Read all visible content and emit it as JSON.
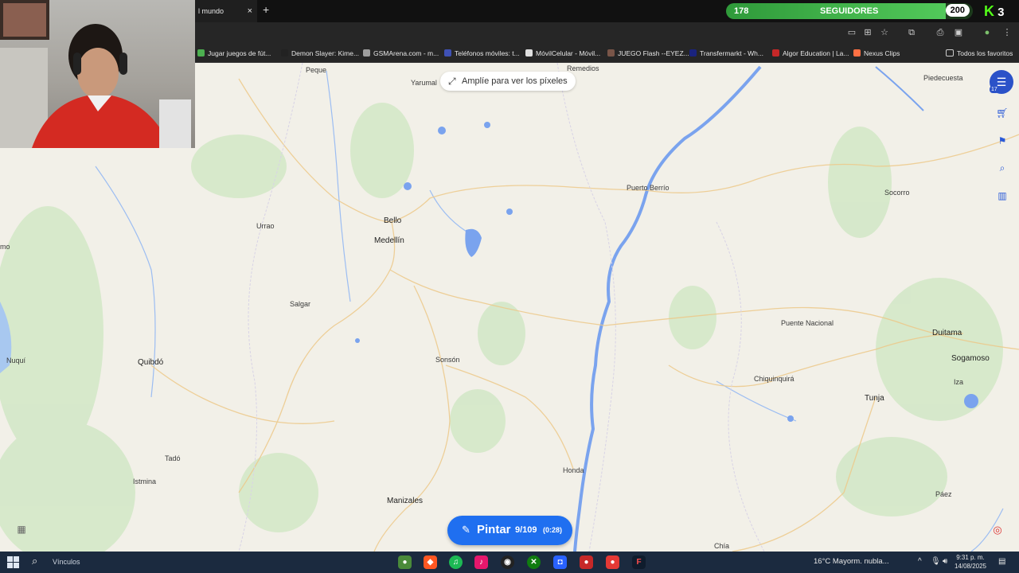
{
  "browser": {
    "tab_title": "l mundo",
    "tab_close": "×",
    "new_tab": "+",
    "bookmarks": [
      {
        "label": "Jugar juegos de fút...",
        "color": "#4caf50"
      },
      {
        "label": "Demon Slayer: Kime...",
        "color": "#222222"
      },
      {
        "label": "GSMArena.com - m...",
        "color": "#9e9e9e"
      },
      {
        "label": "Teléfonos móviles: t...",
        "color": "#3f51b5"
      },
      {
        "label": "MóvilCelular - Móvil...",
        "color": "#e0e0e0"
      },
      {
        "label": "JUEGO Flash --EYEZ...",
        "color": "#795548"
      },
      {
        "label": "Transfermarkt - Wh...",
        "color": "#1a237e"
      },
      {
        "label": "Algor Education | La...",
        "color": "#c62828"
      },
      {
        "label": "Nexus Clips",
        "color": "#ff7043"
      }
    ],
    "all_bookmarks": "Todos los favoritos"
  },
  "stream": {
    "followers_current": "178",
    "followers_label": "SEGUIDORES",
    "followers_goal": "200",
    "followers_progress": 0.89,
    "kick_letter": "K",
    "kick_count": "3"
  },
  "map": {
    "zoom_hint": "Amplíe para ver los píxeles",
    "cities": [
      {
        "name": "Peque",
        "bold": false
      },
      {
        "name": "Yarumal",
        "bold": false
      },
      {
        "name": "Remedios",
        "bold": false
      },
      {
        "name": "Piedecuesta",
        "bold": false
      },
      {
        "name": "Puerto Berrío",
        "bold": false
      },
      {
        "name": "Socorro",
        "bold": false
      },
      {
        "name": "Bello",
        "bold": true
      },
      {
        "name": "Medellín",
        "bold": true
      },
      {
        "name": "Urrao",
        "bold": false
      },
      {
        "name": "Salgar",
        "bold": false
      },
      {
        "name": "Puente Nacional",
        "bold": false
      },
      {
        "name": "Duitama",
        "bold": true
      },
      {
        "name": "Sogamoso",
        "bold": true
      },
      {
        "name": "Nuquí",
        "bold": false
      },
      {
        "name": "Quibdó",
        "bold": true
      },
      {
        "name": "Sonsón",
        "bold": false
      },
      {
        "name": "Chiquinquirá",
        "bold": false
      },
      {
        "name": "Tunja",
        "bold": true
      },
      {
        "name": "Iza",
        "bold": false
      },
      {
        "name": "Tadó",
        "bold": false
      },
      {
        "name": "Istmina",
        "bold": false
      },
      {
        "name": "Honda",
        "bold": false
      },
      {
        "name": "Páez",
        "bold": false
      },
      {
        "name": "Manizales",
        "bold": true
      },
      {
        "name": "Chía",
        "bold": false
      },
      {
        "name": "mo",
        "bold": false
      }
    ],
    "logo_badge": "17"
  },
  "paint": {
    "label": "Pintar",
    "charges": "9/109",
    "timer": "(0:28)"
  },
  "taskbar": {
    "search_label": "Vínculos",
    "weather": "16°C  Mayorm. nubla...",
    "time": "9:31 p. m.",
    "date": "14/08/2025"
  }
}
